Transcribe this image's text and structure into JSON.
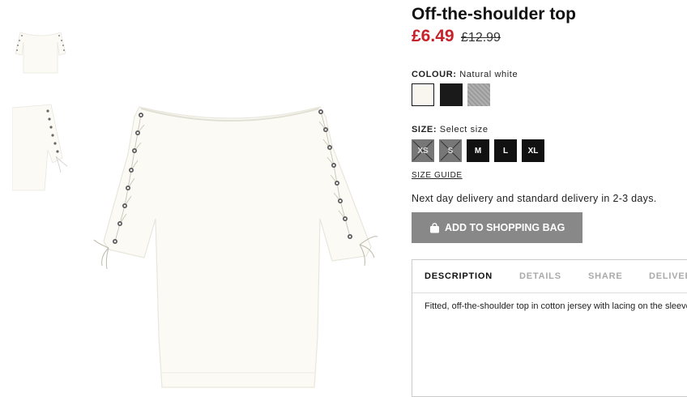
{
  "product": {
    "title": "Off-the-shoulder top",
    "price": "£6.49",
    "old_price": "£12.99"
  },
  "colour": {
    "label": "COLOUR:",
    "selected": "Natural white",
    "swatches": [
      {
        "name": "Natural white",
        "color": "#f8f6ee"
      },
      {
        "name": "Black",
        "color": "#1a1a1a"
      },
      {
        "name": "Grey marl",
        "color": "#a0a0a0"
      }
    ]
  },
  "size": {
    "label": "SIZE:",
    "prompt": "Select size",
    "options": [
      {
        "label": "XS",
        "available": false
      },
      {
        "label": "S",
        "available": false
      },
      {
        "label": "M",
        "available": true
      },
      {
        "label": "L",
        "available": true
      },
      {
        "label": "XL",
        "available": true
      }
    ],
    "guide_label": "SIZE GUIDE"
  },
  "delivery_text": "Next day delivery and standard delivery in 2-3 days.",
  "add_to_bag_label": "ADD TO SHOPPING BAG",
  "tabs": [
    {
      "label": "DESCRIPTION",
      "active": true
    },
    {
      "label": "DETAILS",
      "active": false
    },
    {
      "label": "SHARE",
      "active": false
    },
    {
      "label": "DELIVERY",
      "active": false
    }
  ],
  "description": "Fitted, off-the-shoulder top in cotton jersey with lacing on the sleeves.",
  "colors": {
    "sale_red": "#c7222a",
    "button_grey": "#888888"
  }
}
